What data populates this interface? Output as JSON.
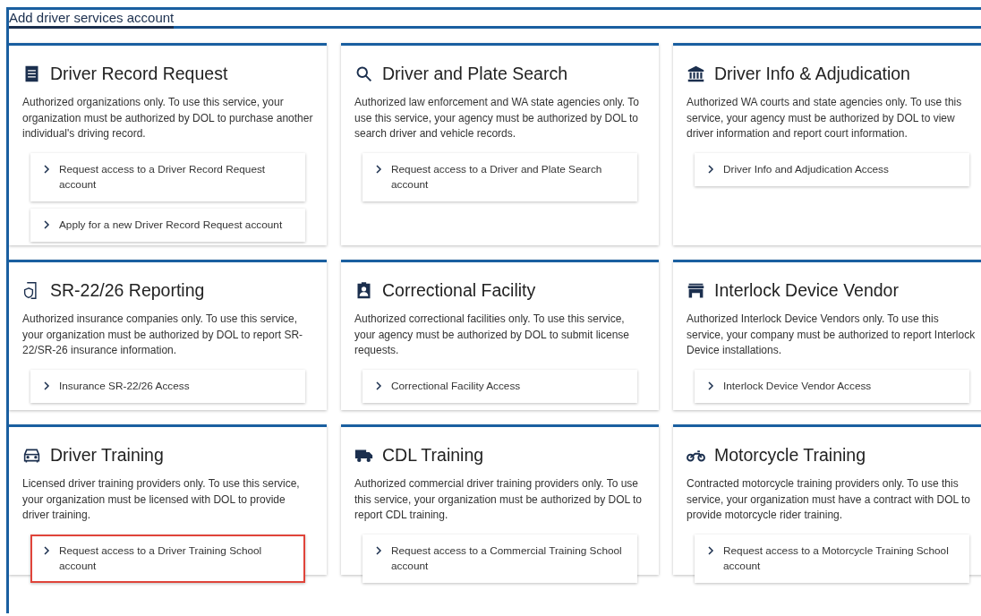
{
  "heading": "Add driver services account",
  "cards": [
    {
      "title": "Driver Record Request",
      "description": "Authorized organizations only. To use this service, your organization must be authorized by DOL to purchase another individual's driving record.",
      "links": [
        {
          "label": "Request access to a Driver Record Request account",
          "highlighted": false
        },
        {
          "label": "Apply for a new Driver Record Request account",
          "highlighted": false
        }
      ]
    },
    {
      "title": "Driver and Plate Search",
      "description": "Authorized law enforcement and WA state agencies only. To use this service, your agency must be authorized by DOL to search driver and vehicle records.",
      "links": [
        {
          "label": "Request access to a Driver and Plate Search account",
          "highlighted": false
        }
      ]
    },
    {
      "title": "Driver Info & Adjudication",
      "description": "Authorized WA courts and state agencies only. To use this service, your agency must be authorized by DOL to view driver information and report court information.",
      "links": [
        {
          "label": "Driver Info and Adjudication Access",
          "highlighted": false
        }
      ]
    },
    {
      "title": "SR-22/26 Reporting",
      "description": "Authorized insurance companies only. To use this service, your organization must be authorized by DOL to report SR-22/SR-26 insurance information.",
      "links": [
        {
          "label": "Insurance SR-22/26 Access",
          "highlighted": false
        }
      ]
    },
    {
      "title": "Correctional Facility",
      "description": "Authorized correctional facilities only. To use this service, your agency must be authorized by DOL to submit license requests.",
      "links": [
        {
          "label": "Correctional Facility Access",
          "highlighted": false
        }
      ]
    },
    {
      "title": "Interlock Device Vendor",
      "description": "Authorized Interlock Device Vendors only. To use this service, your company must be authorized to report Interlock Device installations.",
      "links": [
        {
          "label": "Interlock Device Vendor Access",
          "highlighted": false
        }
      ]
    },
    {
      "title": "Driver Training",
      "description": "Licensed driver training providers only. To use this service, your organization must be licensed with DOL to provide driver training.",
      "links": [
        {
          "label": "Request access to a Driver Training School account",
          "highlighted": true
        }
      ]
    },
    {
      "title": "CDL Training",
      "description": "Authorized commercial driver training providers only. To use this service, your organization must be authorized by DOL to report CDL training.",
      "links": [
        {
          "label": "Request access to a Commercial Training School account",
          "highlighted": false
        }
      ]
    },
    {
      "title": "Motorcycle Training",
      "description": "Contracted motorcycle training providers only. To use this service, your organization must have a contract with DOL to provide motorcycle rider training.",
      "links": [
        {
          "label": "Request access to a Motorcycle Training School account",
          "highlighted": false
        }
      ]
    }
  ]
}
